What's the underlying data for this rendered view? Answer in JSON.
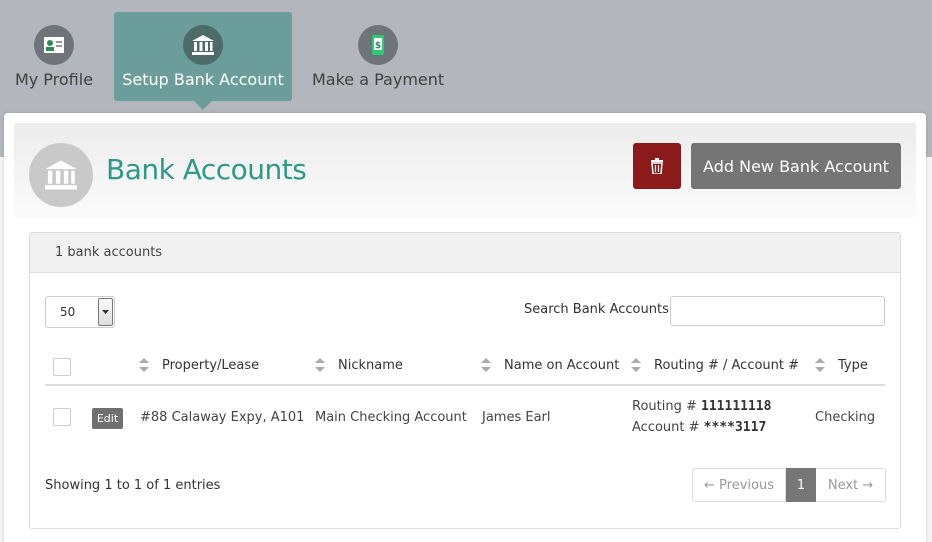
{
  "nav": {
    "tabs": [
      {
        "label": "My Profile",
        "icon": "profile-card-icon"
      },
      {
        "label": "Setup Bank Account",
        "icon": "bank-icon",
        "active": true
      },
      {
        "label": "Make a Payment",
        "icon": "phone-dollar-icon"
      }
    ]
  },
  "header": {
    "title": "Bank Accounts",
    "add_button": "Add New Bank Account",
    "delete_icon": "trash-icon"
  },
  "panel": {
    "count_label": "1 bank accounts",
    "length_value": "50",
    "search_label": "Search Bank Accounts:",
    "search_value": ""
  },
  "table": {
    "columns": [
      "Property/Lease",
      "Nickname",
      "Name on Account",
      "Routing # / Account #",
      "Type"
    ],
    "rows": [
      {
        "edit_label": "Edit",
        "property": "#88 Calaway Expy, A101",
        "nickname": "Main Checking Account",
        "name": "James Earl",
        "routing_label": "Routing #",
        "routing_value": "111111118",
        "account_label": "Account #",
        "account_value": "****3117",
        "type": "Checking"
      }
    ]
  },
  "footer": {
    "info": "Showing 1 to 1 of 1 entries",
    "prev": "← Previous",
    "page": "1",
    "next": "Next →"
  },
  "colors": {
    "accent": "#2e9a86",
    "active_tab": "#6b9e9a",
    "delete": "#8b1a1a",
    "button": "#757575"
  }
}
